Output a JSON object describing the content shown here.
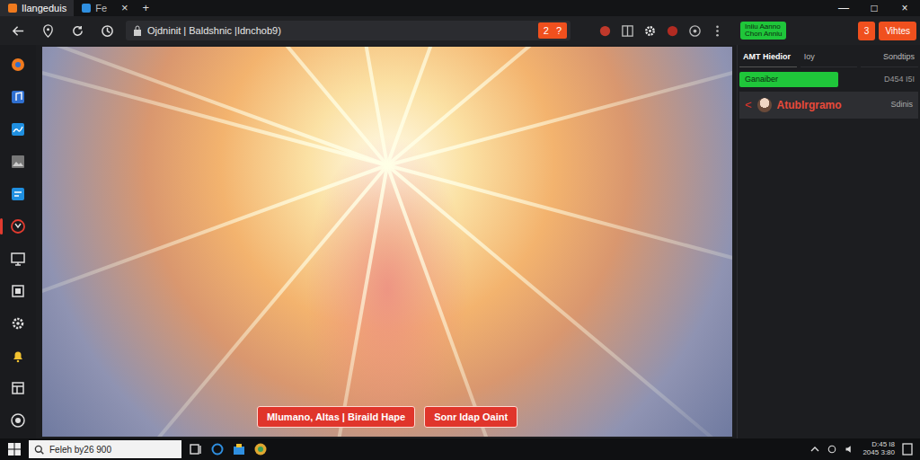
{
  "window": {
    "controls": [
      "—",
      "□",
      "×"
    ]
  },
  "tabs": [
    {
      "label": "Ilangeduis",
      "selected": true
    },
    {
      "label": "Fe",
      "selected": false
    }
  ],
  "tab_close": "×",
  "new_tab": "+",
  "address_bar": {
    "url": "Ojdninit | Baldshnic |Idnchob9)",
    "badge": "2",
    "badge_icon": "?"
  },
  "toolbar_panel": {
    "green_button": [
      "Iniiu Aanno",
      "Chon Anniu"
    ],
    "count": "3",
    "button": "Vihtes"
  },
  "sidebar": {
    "items": [
      {
        "kind": "browser",
        "selected": false
      },
      {
        "kind": "music",
        "selected": false
      },
      {
        "kind": "chart",
        "selected": false
      },
      {
        "kind": "photo",
        "selected": false
      },
      {
        "kind": "message",
        "selected": false
      },
      {
        "kind": "alert",
        "selected": true
      },
      {
        "kind": "screen",
        "selected": false
      },
      {
        "kind": "box",
        "selected": false
      },
      {
        "kind": "settings",
        "selected": false
      },
      {
        "kind": "bell",
        "selected": false
      },
      {
        "kind": "layout",
        "selected": false
      },
      {
        "kind": "record",
        "selected": false
      }
    ]
  },
  "viewer": {
    "buttons": [
      "Mlumano, Altas | Biraild Hape",
      "Sonr Idap Oaint"
    ]
  },
  "panel": {
    "tabs": [
      {
        "label": "AMT Hiedior",
        "selected": true
      },
      {
        "label": "Ioy",
        "selected": false
      },
      {
        "label": "Sondtips",
        "selected": false
      }
    ],
    "green_bar": "Ganaiber",
    "reading": "D454 I5I",
    "item": {
      "back": "<",
      "name": "Atublrgramo",
      "status": "Sdinis"
    }
  },
  "taskbar": {
    "search": "Feleh by26 900",
    "clock": [
      "D:45 I8",
      "2045 3:80"
    ]
  }
}
